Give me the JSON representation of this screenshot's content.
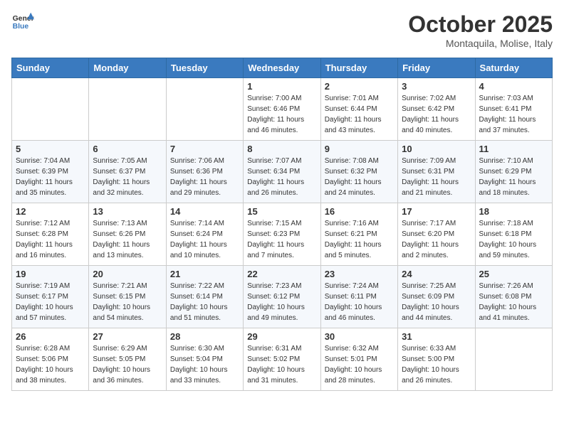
{
  "header": {
    "logo_line1": "General",
    "logo_line2": "Blue",
    "month": "October 2025",
    "location": "Montaquila, Molise, Italy"
  },
  "weekdays": [
    "Sunday",
    "Monday",
    "Tuesday",
    "Wednesday",
    "Thursday",
    "Friday",
    "Saturday"
  ],
  "weeks": [
    [
      {
        "day": "",
        "info": ""
      },
      {
        "day": "",
        "info": ""
      },
      {
        "day": "",
        "info": ""
      },
      {
        "day": "1",
        "info": "Sunrise: 7:00 AM\nSunset: 6:46 PM\nDaylight: 11 hours\nand 46 minutes."
      },
      {
        "day": "2",
        "info": "Sunrise: 7:01 AM\nSunset: 6:44 PM\nDaylight: 11 hours\nand 43 minutes."
      },
      {
        "day": "3",
        "info": "Sunrise: 7:02 AM\nSunset: 6:42 PM\nDaylight: 11 hours\nand 40 minutes."
      },
      {
        "day": "4",
        "info": "Sunrise: 7:03 AM\nSunset: 6:41 PM\nDaylight: 11 hours\nand 37 minutes."
      }
    ],
    [
      {
        "day": "5",
        "info": "Sunrise: 7:04 AM\nSunset: 6:39 PM\nDaylight: 11 hours\nand 35 minutes."
      },
      {
        "day": "6",
        "info": "Sunrise: 7:05 AM\nSunset: 6:37 PM\nDaylight: 11 hours\nand 32 minutes."
      },
      {
        "day": "7",
        "info": "Sunrise: 7:06 AM\nSunset: 6:36 PM\nDaylight: 11 hours\nand 29 minutes."
      },
      {
        "day": "8",
        "info": "Sunrise: 7:07 AM\nSunset: 6:34 PM\nDaylight: 11 hours\nand 26 minutes."
      },
      {
        "day": "9",
        "info": "Sunrise: 7:08 AM\nSunset: 6:32 PM\nDaylight: 11 hours\nand 24 minutes."
      },
      {
        "day": "10",
        "info": "Sunrise: 7:09 AM\nSunset: 6:31 PM\nDaylight: 11 hours\nand 21 minutes."
      },
      {
        "day": "11",
        "info": "Sunrise: 7:10 AM\nSunset: 6:29 PM\nDaylight: 11 hours\nand 18 minutes."
      }
    ],
    [
      {
        "day": "12",
        "info": "Sunrise: 7:12 AM\nSunset: 6:28 PM\nDaylight: 11 hours\nand 16 minutes."
      },
      {
        "day": "13",
        "info": "Sunrise: 7:13 AM\nSunset: 6:26 PM\nDaylight: 11 hours\nand 13 minutes."
      },
      {
        "day": "14",
        "info": "Sunrise: 7:14 AM\nSunset: 6:24 PM\nDaylight: 11 hours\nand 10 minutes."
      },
      {
        "day": "15",
        "info": "Sunrise: 7:15 AM\nSunset: 6:23 PM\nDaylight: 11 hours\nand 7 minutes."
      },
      {
        "day": "16",
        "info": "Sunrise: 7:16 AM\nSunset: 6:21 PM\nDaylight: 11 hours\nand 5 minutes."
      },
      {
        "day": "17",
        "info": "Sunrise: 7:17 AM\nSunset: 6:20 PM\nDaylight: 11 hours\nand 2 minutes."
      },
      {
        "day": "18",
        "info": "Sunrise: 7:18 AM\nSunset: 6:18 PM\nDaylight: 10 hours\nand 59 minutes."
      }
    ],
    [
      {
        "day": "19",
        "info": "Sunrise: 7:19 AM\nSunset: 6:17 PM\nDaylight: 10 hours\nand 57 minutes."
      },
      {
        "day": "20",
        "info": "Sunrise: 7:21 AM\nSunset: 6:15 PM\nDaylight: 10 hours\nand 54 minutes."
      },
      {
        "day": "21",
        "info": "Sunrise: 7:22 AM\nSunset: 6:14 PM\nDaylight: 10 hours\nand 51 minutes."
      },
      {
        "day": "22",
        "info": "Sunrise: 7:23 AM\nSunset: 6:12 PM\nDaylight: 10 hours\nand 49 minutes."
      },
      {
        "day": "23",
        "info": "Sunrise: 7:24 AM\nSunset: 6:11 PM\nDaylight: 10 hours\nand 46 minutes."
      },
      {
        "day": "24",
        "info": "Sunrise: 7:25 AM\nSunset: 6:09 PM\nDaylight: 10 hours\nand 44 minutes."
      },
      {
        "day": "25",
        "info": "Sunrise: 7:26 AM\nSunset: 6:08 PM\nDaylight: 10 hours\nand 41 minutes."
      }
    ],
    [
      {
        "day": "26",
        "info": "Sunrise: 6:28 AM\nSunset: 5:06 PM\nDaylight: 10 hours\nand 38 minutes."
      },
      {
        "day": "27",
        "info": "Sunrise: 6:29 AM\nSunset: 5:05 PM\nDaylight: 10 hours\nand 36 minutes."
      },
      {
        "day": "28",
        "info": "Sunrise: 6:30 AM\nSunset: 5:04 PM\nDaylight: 10 hours\nand 33 minutes."
      },
      {
        "day": "29",
        "info": "Sunrise: 6:31 AM\nSunset: 5:02 PM\nDaylight: 10 hours\nand 31 minutes."
      },
      {
        "day": "30",
        "info": "Sunrise: 6:32 AM\nSunset: 5:01 PM\nDaylight: 10 hours\nand 28 minutes."
      },
      {
        "day": "31",
        "info": "Sunrise: 6:33 AM\nSunset: 5:00 PM\nDaylight: 10 hours\nand 26 minutes."
      },
      {
        "day": "",
        "info": ""
      }
    ]
  ]
}
